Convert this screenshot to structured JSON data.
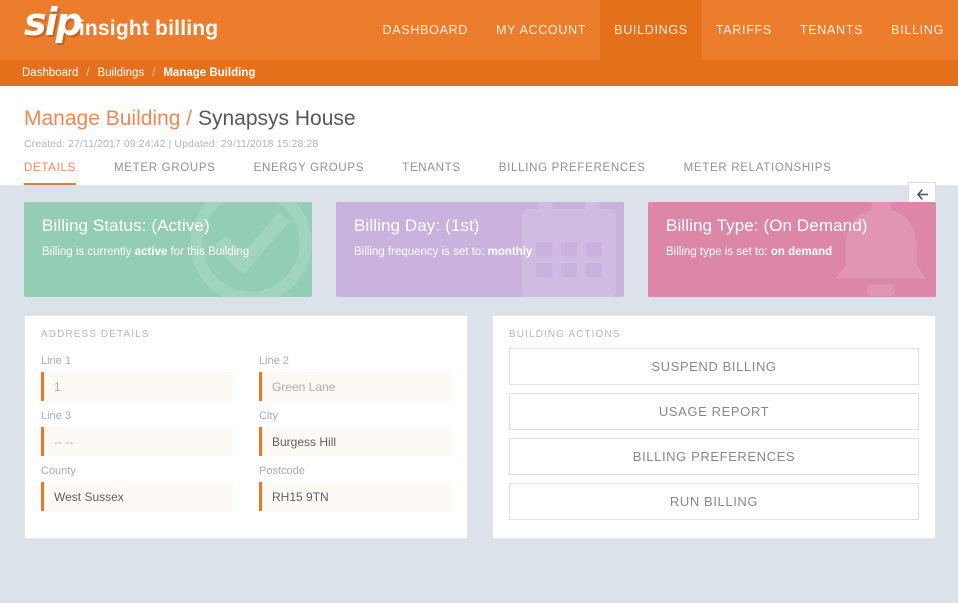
{
  "brand": {
    "logo_text": "sip",
    "product_name": "insight billing"
  },
  "nav": {
    "items": [
      {
        "label": "DASHBOARD",
        "active": false
      },
      {
        "label": "MY ACCOUNT",
        "active": false
      },
      {
        "label": "BUILDINGS",
        "active": true
      },
      {
        "label": "TARIFFS",
        "active": false
      },
      {
        "label": "TENANTS",
        "active": false
      },
      {
        "label": "BILLING",
        "active": false
      }
    ]
  },
  "breadcrumb": {
    "item1": "Dashboard",
    "sep1": "/",
    "item2": "Buildings",
    "sep2": "/",
    "item3": "Manage Building"
  },
  "page": {
    "title_prefix": "Manage Building /",
    "title_name": "Synapsys House",
    "meta": "Created: 27/11/2017 09:24:42  |  Updated: 29/11/2018 15:28:28",
    "back_icon": "arrow-left-icon"
  },
  "tabs": [
    {
      "label": "DETAILS",
      "active": true
    },
    {
      "label": "METER GROUPS",
      "active": false
    },
    {
      "label": "ENERGY GROUPS",
      "active": false
    },
    {
      "label": "TENANTS",
      "active": false
    },
    {
      "label": "BILLING PREFERENCES",
      "active": false
    },
    {
      "label": "METER RELATIONSHIPS",
      "active": false
    }
  ],
  "cards": [
    {
      "title": "Billing Status: (Active)",
      "desc_pre": "Billing is currently ",
      "desc_strong": "active",
      "desc_post": " for this Building",
      "color": "#93ceb4",
      "icon": "check-circle-icon"
    },
    {
      "title": "Billing Day: (1st)",
      "desc_pre": "Billing frequency is set to: ",
      "desc_strong": "monthly",
      "desc_post": "",
      "color": "#c9b2de",
      "icon": "calendar-icon"
    },
    {
      "title": "Billing Type: (On Demand)",
      "desc_pre": "Billing type is set to: ",
      "desc_strong": "on demand",
      "desc_post": "",
      "color": "#dc87a8",
      "icon": "bell-icon"
    }
  ],
  "address": {
    "section_label": "ADDRESS DETAILS",
    "fields": [
      {
        "label": "Line 1",
        "value": "1",
        "placeholder": "Line 1",
        "is_placeholder": true
      },
      {
        "label": "Line 2",
        "value": "Green Lane",
        "placeholder": "Line 2",
        "is_placeholder": true
      },
      {
        "label": "Line 3",
        "value": "-- --",
        "placeholder": "Line 3",
        "is_placeholder": true
      },
      {
        "label": "City",
        "value": "Burgess Hill",
        "placeholder": "City",
        "is_placeholder": false
      },
      {
        "label": "County",
        "value": "West Sussex",
        "placeholder": "County",
        "is_placeholder": false
      },
      {
        "label": "Postcode",
        "value": "RH15 9TN",
        "placeholder": "Postcode",
        "is_placeholder": false
      }
    ]
  },
  "actions": {
    "section_label": "BUILDING ACTIONS",
    "buttons": [
      {
        "label": "SUSPEND BILLING"
      },
      {
        "label": "USAGE REPORT"
      },
      {
        "label": "BILLING PREFERENCES"
      },
      {
        "label": "RUN BILLING"
      }
    ]
  },
  "colors": {
    "header_orange": "#ec7d2d",
    "accent_orange": "#e5701b",
    "page_bg": "#dce2ea",
    "field_accent": "#ee7623"
  }
}
